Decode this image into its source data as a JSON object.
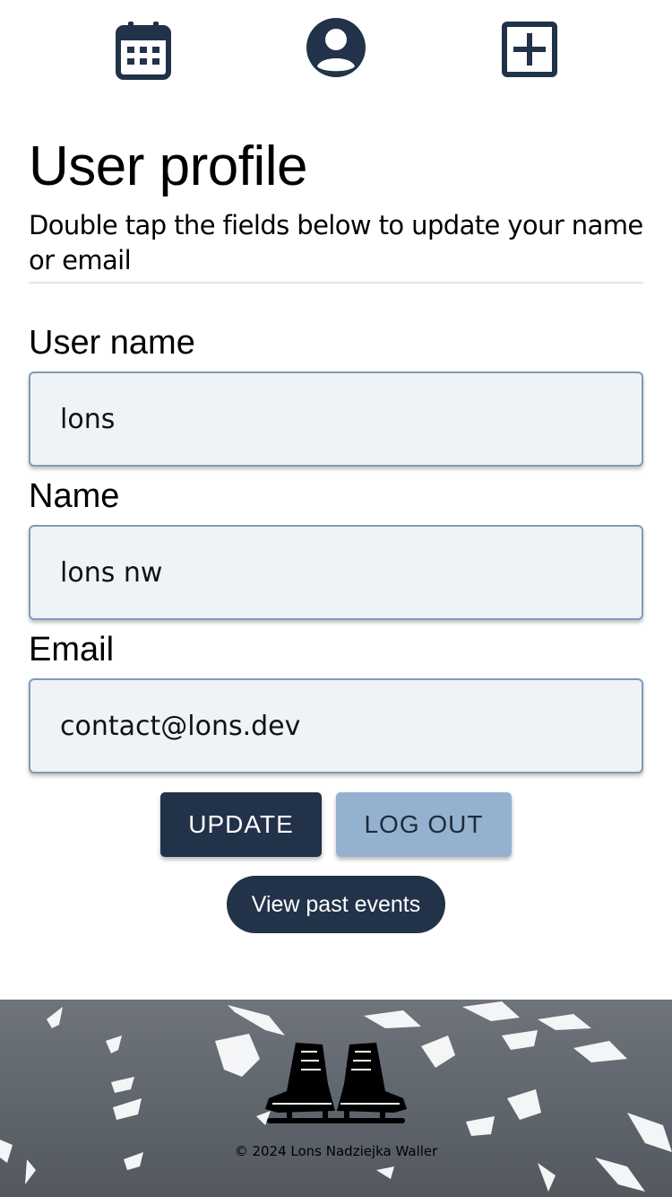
{
  "nav": {
    "items": [
      {
        "icon": "calendar-icon"
      },
      {
        "icon": "user-circle-icon"
      },
      {
        "icon": "plus-square-icon"
      }
    ]
  },
  "header": {
    "title": "User profile",
    "subtitle": "Double tap the fields below to update your name or email"
  },
  "form": {
    "username": {
      "label": "User name",
      "value": "lons"
    },
    "name": {
      "label": "Name",
      "value": "lons nw"
    },
    "email": {
      "label": "Email",
      "value": "contact@lons.dev"
    }
  },
  "actions": {
    "update_label": "UPDATE",
    "logout_label": "LOG OUT",
    "past_events_label": "View past events"
  },
  "footer": {
    "copyright": "© 2024 Lons Nadziejka Waller",
    "logo_icon": "ice-skates-icon"
  },
  "colors": {
    "primary": "#213249",
    "secondary": "#94b1cf",
    "field_bg": "#eff2f7",
    "field_border": "#7f9bbb"
  }
}
